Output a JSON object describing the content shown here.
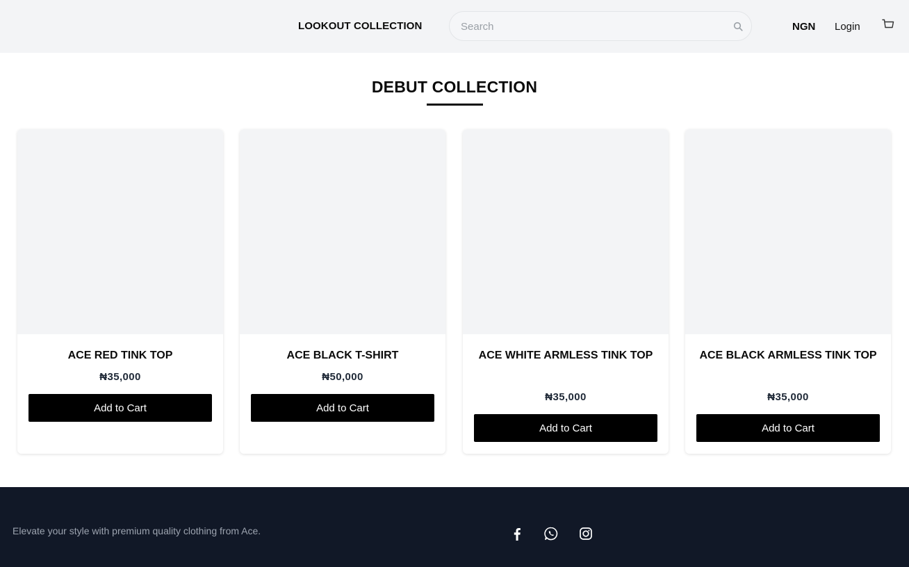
{
  "header": {
    "brand": "LOOKOUT COLLECTION",
    "search_placeholder": "Search",
    "currency": "NGN",
    "login_label": "Login",
    "search_icon": "search-icon",
    "cart_icon": "cart-icon"
  },
  "section": {
    "title": "DEBUT COLLECTION"
  },
  "products": [
    {
      "name": "ACE RED TINK TOP",
      "price": "₦35,000",
      "button_label": "Add to Cart"
    },
    {
      "name": "ACE BLACK T-SHIRT",
      "price": "₦50,000",
      "button_label": "Add to Cart"
    },
    {
      "name": "ACE WHITE ARMLESS TINK TOP",
      "price": "₦35,000",
      "button_label": "Add to Cart"
    },
    {
      "name": "ACE BLACK ARMLESS TINK TOP",
      "price": "₦35,000",
      "button_label": "Add to Cart"
    }
  ],
  "footer": {
    "tagline": "Elevate your style with premium quality clothing from Ace.",
    "social_icons": [
      "facebook-icon",
      "whatsapp-icon",
      "instagram-icon"
    ]
  },
  "colors": {
    "header_bg": "#f3f4f6",
    "footer_bg": "#111827",
    "button_bg": "#000000",
    "image_placeholder": "#f3f4f6"
  }
}
